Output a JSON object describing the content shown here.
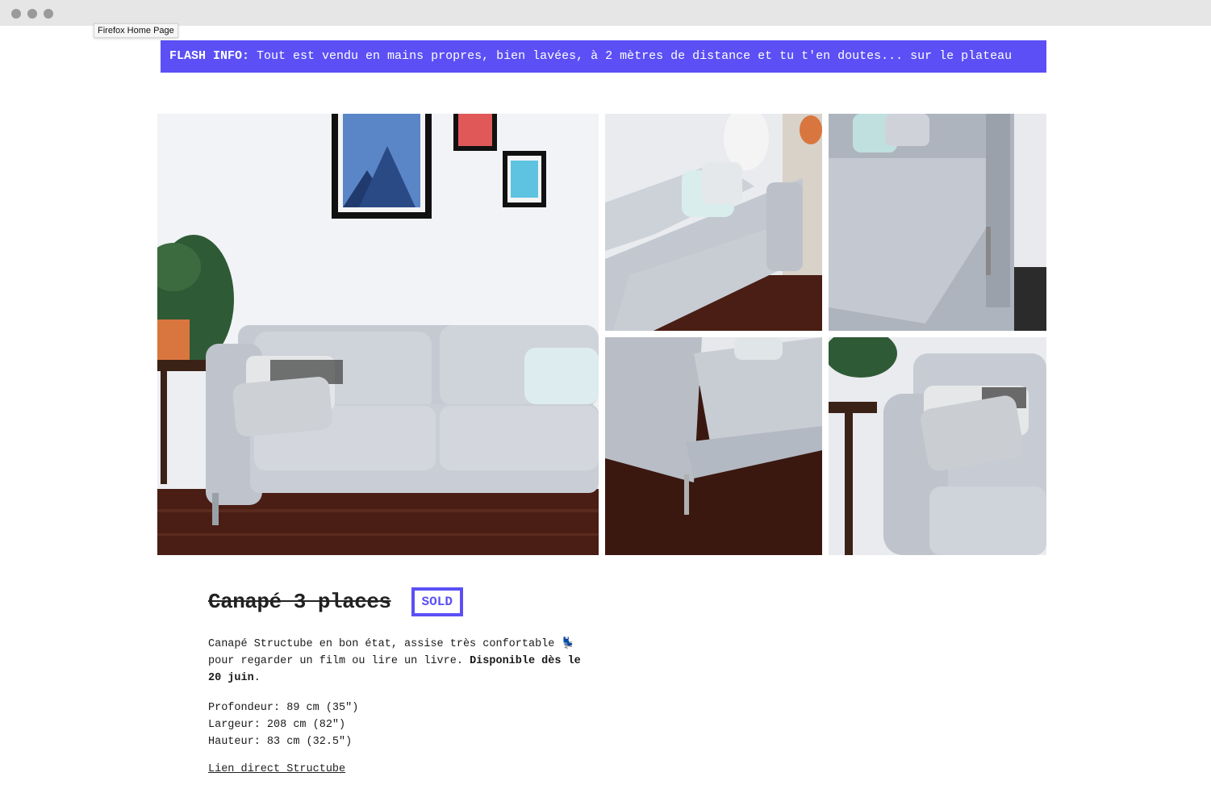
{
  "browser": {
    "tooltip": "Firefox Home Page"
  },
  "flash": {
    "label": "FLASH INFO:",
    "text": " Tout est vendu en mains propres, bien lavées, à 2 mètres de distance et tu t'en doutes... sur le plateau"
  },
  "gallery": {
    "images": [
      "sofa-front-view",
      "sofa-angle-view",
      "sofa-seat-closeup",
      "sofa-corner-leg",
      "sofa-armrest-cushion"
    ]
  },
  "product": {
    "title": "Canapé 3 places",
    "badge": "SOLD",
    "desc_text": "Canapé Structube en bon état, assise très confortable 💺 pour regarder un film ou lire un livre. ",
    "desc_bold": "Disponible dès le 20 juin",
    "desc_end": ".",
    "dims": [
      "Profondeur: 89 cm (35\")",
      "Largeur: 208 cm (82\")",
      "Hauteur: 83 cm (32.5\")"
    ],
    "link": "Lien direct Structube"
  },
  "colors": {
    "accent": "#5b4ff5",
    "sofa": "#c9ced6",
    "floor": "#4a1e14",
    "wall": "#eef0f4"
  }
}
